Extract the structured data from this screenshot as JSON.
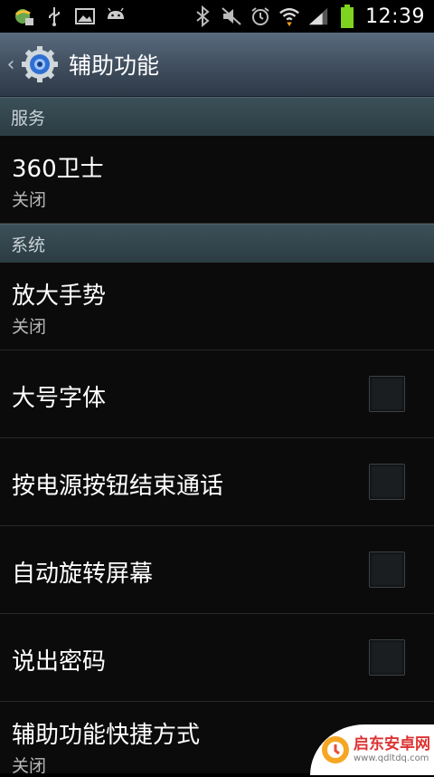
{
  "status_bar": {
    "time": "12:39",
    "icons": [
      "planet-notification-icon",
      "usb-icon",
      "image-icon",
      "android-icon",
      "bluetooth-icon",
      "mute-icon",
      "alarm-icon",
      "wifi-icon",
      "signal-icon",
      "battery-icon"
    ]
  },
  "header": {
    "back_glyph": "‹",
    "title": "辅助功能",
    "icon": "settings-gear-icon"
  },
  "sections": [
    {
      "label": "服务",
      "items": [
        {
          "title": "360卫士",
          "summary": "关闭"
        }
      ]
    },
    {
      "label": "系统",
      "items": [
        {
          "title": "放大手势",
          "summary": "关闭"
        },
        {
          "title": "大号字体",
          "checked": false
        },
        {
          "title": "按电源按钮结束通话",
          "checked": false
        },
        {
          "title": "自动旋转屏幕",
          "checked": false
        },
        {
          "title": "说出密码",
          "checked": false
        },
        {
          "title": "辅助功能快捷方式",
          "summary": "关闭"
        }
      ]
    }
  ],
  "watermark": {
    "text": "启东安卓网",
    "url": "www.qdltdq.com"
  },
  "colors": {
    "accent_battery": "#7ed321",
    "header_bg": "#4a5a6c",
    "section_bg": "#33474f"
  }
}
